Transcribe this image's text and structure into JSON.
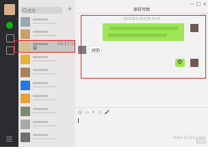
{
  "sidebar": {
    "icons": [
      "chat-icon",
      "contacts-icon",
      "favorites-icon",
      "menu-icon"
    ],
    "accent": "#1aad19"
  },
  "search": {
    "placeholder": "搜索"
  },
  "conversations": {
    "selected": {
      "time": "15:17:17",
      "preview_emoji": "😊"
    },
    "avatar_colors": [
      "#9aa6b0",
      "#c9a06a",
      "#d8c08a",
      "#e7b23a",
      "#a7815c",
      "#1f7be0",
      "#e4a236",
      "#7c8a72",
      "#a8a8a8",
      "#6f6f6f",
      "#b9b9b9",
      "#9a9a9a"
    ]
  },
  "chat": {
    "title": "原样传图",
    "timestamp": "2016年11月17日 9:34",
    "incoming_text": "好的",
    "outgoing_emoji": "😊",
    "tools": [
      "☺",
      "▭",
      "✂",
      "▢",
      "🎤"
    ],
    "window_controls": [
      "−",
      "□",
      "×"
    ],
    "more": "···",
    "colors": {
      "bubble_out": "#9fe658",
      "bubble_in": "#ffffff"
    }
  },
  "annotations": {
    "color": "#e0211f"
  },
  "watermark": "www.baidu.com"
}
